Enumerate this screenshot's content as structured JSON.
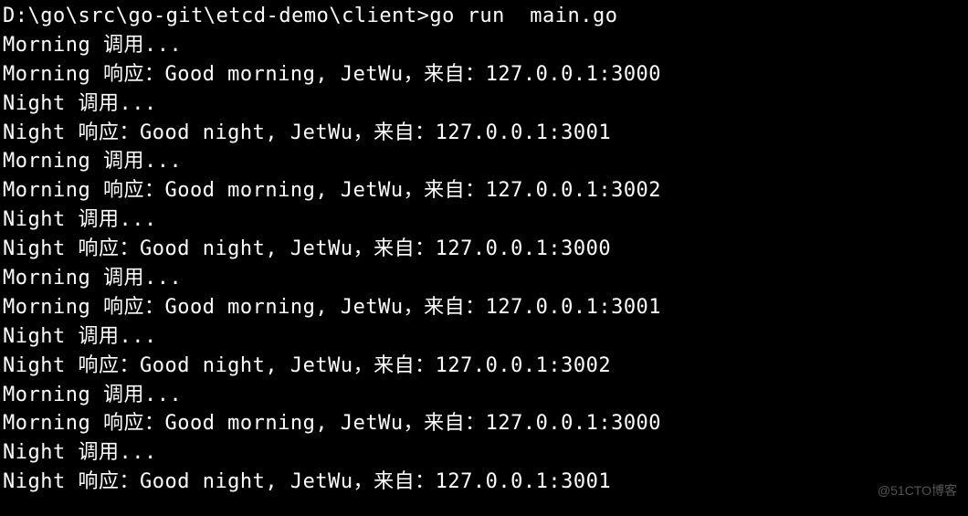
{
  "terminal": {
    "prompt": "D:\\go\\src\\go-git\\etcd-demo\\client>",
    "command": "go run  main.go",
    "lines": [
      "Morning 调用...",
      "Morning 响应：Good morning, JetWu，来自：127.0.0.1:3000",
      "Night 调用...",
      "Night 响应：Good night, JetWu，来自：127.0.0.1:3001",
      "Morning 调用...",
      "Morning 响应：Good morning, JetWu，来自：127.0.0.1:3002",
      "Night 调用...",
      "Night 响应：Good night, JetWu，来自：127.0.0.1:3000",
      "Morning 调用...",
      "Morning 响应：Good morning, JetWu，来自：127.0.0.1:3001",
      "Night 调用...",
      "Night 响应：Good night, JetWu，来自：127.0.0.1:3002",
      "Morning 调用...",
      "Morning 响应：Good morning, JetWu，来自：127.0.0.1:3000",
      "Night 调用...",
      "Night 响应：Good night, JetWu，来自：127.0.0.1:3001"
    ]
  },
  "watermark": "@51CTO博客"
}
